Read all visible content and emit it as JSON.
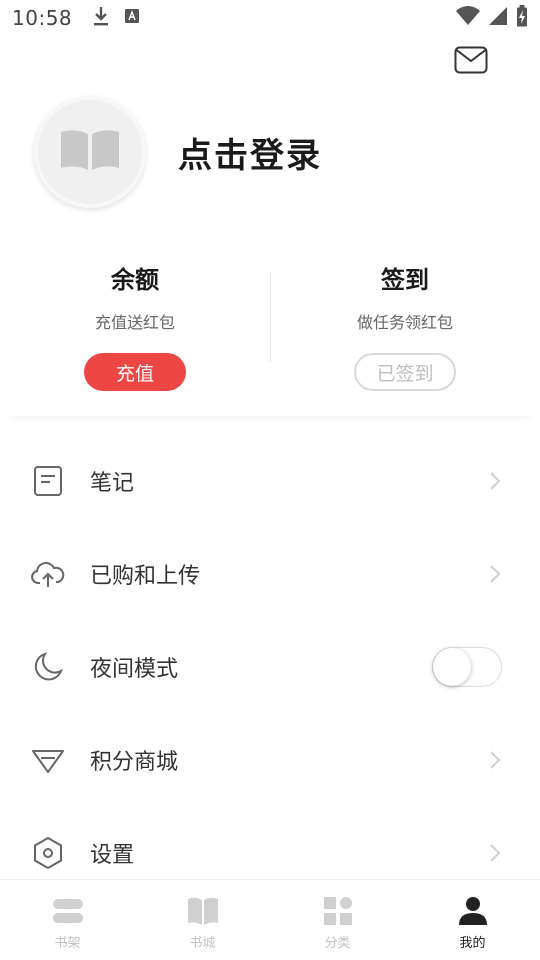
{
  "status_bar": {
    "time": "10:58",
    "icons": [
      "download-icon",
      "a-notification-icon",
      "wifi-icon",
      "signal-icon",
      "battery-charging-icon"
    ]
  },
  "header": {
    "mail_icon": "mail-icon"
  },
  "profile": {
    "avatar_icon": "open-book-icon",
    "login_text": "点击登录"
  },
  "balance": {
    "title": "余额",
    "subtitle": "充值送红包",
    "button_label": "充值"
  },
  "checkin": {
    "title": "签到",
    "subtitle": "做任务领红包",
    "button_label": "已签到"
  },
  "menu": {
    "items": [
      {
        "label": "笔记",
        "icon": "note-icon"
      },
      {
        "label": "已购和上传",
        "icon": "cloud-upload-icon"
      },
      {
        "label": "夜间模式",
        "icon": "moon-icon",
        "toggle": false
      },
      {
        "label": "积分商城",
        "icon": "diamond-icon"
      },
      {
        "label": "设置",
        "icon": "hexagon-settings-icon"
      }
    ]
  },
  "bottom_nav": {
    "items": [
      {
        "label": "书架",
        "icon": "bookshelf-icon",
        "active": false
      },
      {
        "label": "书城",
        "icon": "book-store-icon",
        "active": false
      },
      {
        "label": "分类",
        "icon": "category-icon",
        "active": false
      },
      {
        "label": "我的",
        "icon": "user-icon",
        "active": true
      }
    ]
  },
  "colors": {
    "accent": "#ee4545",
    "text_primary": "#1a1a1a",
    "text_secondary": "#666666",
    "icon_gray": "#cfcfcf"
  }
}
